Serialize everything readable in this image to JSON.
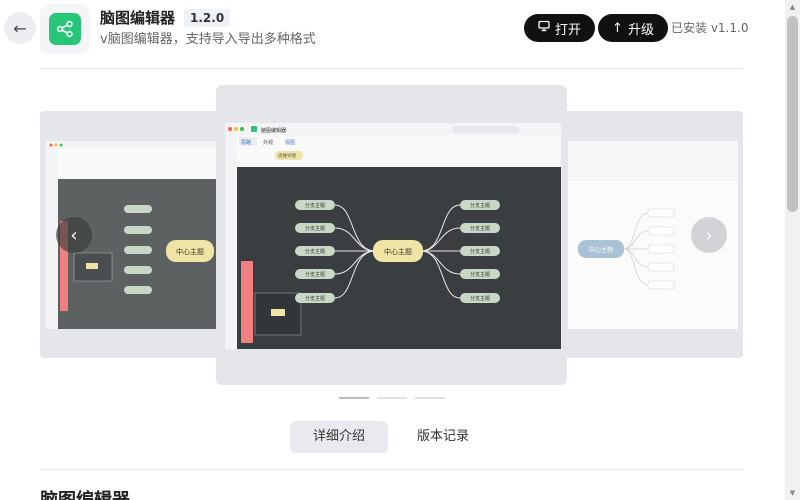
{
  "app": {
    "name": "脑图编辑器",
    "version": "1.2.0",
    "description": "v脑图编辑器，支持导入导出多种格式",
    "open_label": "打开",
    "upgrade_label": "升级",
    "installed_text": "已安装 v1.1.0"
  },
  "screenshot": {
    "window_title": "脑图编辑器",
    "ribbon_tabs": [
      "思路",
      "外观",
      "视图"
    ],
    "center_node": "中心主题",
    "branch_node": "分支主题",
    "theme_label": "思维导图"
  },
  "detail_tabs": [
    {
      "label": "详细介绍",
      "active": true
    },
    {
      "label": "版本记录",
      "active": false
    }
  ],
  "section_title": "脑图编辑器",
  "colors": {
    "accent_green": "#27c77a",
    "button_dark": "#111111",
    "canvas_dark": "#3a3e40",
    "node_center": "#f0e3a6",
    "node_branch": "#c9d8c6",
    "toolbar_red": "#f08080"
  }
}
